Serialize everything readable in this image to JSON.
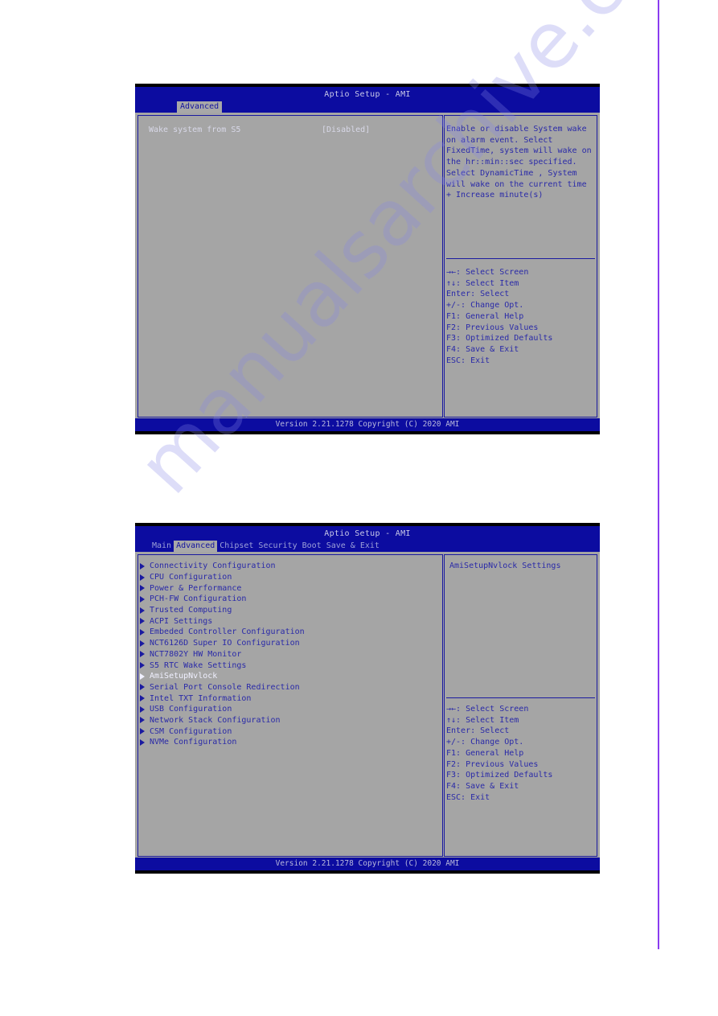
{
  "watermark": "manualsarchive.com",
  "screens": [
    {
      "title": "Aptio Setup - AMI",
      "tabs": [
        {
          "label": "Advanced",
          "active": true
        }
      ],
      "settings": [
        {
          "label": "Wake system from S5",
          "value": "[Disabled]"
        }
      ],
      "help_text": [
        "Enable or disable System wake",
        "on alarm event. Select",
        "FixedTime, system will wake on",
        "the hr::min::sec specified.",
        "Select DynamicTime , System",
        "will wake on the current time",
        "+ Increase minute(s)"
      ],
      "keys": [
        "→←: Select Screen",
        "↑↓: Select Item",
        "Enter: Select",
        "+/-: Change Opt.",
        "F1: General Help",
        "F2: Previous Values",
        "F3: Optimized Defaults",
        "F4: Save & Exit",
        "ESC: Exit"
      ],
      "footer": "Version 2.21.1278 Copyright (C) 2020 AMI"
    },
    {
      "title": "Aptio Setup - AMI",
      "tabs": [
        {
          "label": "Main",
          "active": false
        },
        {
          "label": "Advanced",
          "active": true
        },
        {
          "label": "Chipset",
          "active": false
        },
        {
          "label": "Security",
          "active": false
        },
        {
          "label": "Boot",
          "active": false
        },
        {
          "label": "Save & Exit",
          "active": false
        }
      ],
      "menu": [
        "Connectivity Configuration",
        "CPU Configuration",
        "Power & Performance",
        "PCH-FW Configuration",
        "Trusted Computing",
        "ACPI Settings",
        "Embeded Controller Configuration",
        "NCT6126D Super IO Configuration",
        "NCT7802Y HW Monitor",
        "S5 RTC Wake Settings",
        "AmiSetupNvlock",
        "Serial Port Console Redirection",
        "Intel TXT Information",
        "USB Configuration",
        "Network Stack Configuration",
        "CSM Configuration",
        "NVMe Configuration"
      ],
      "selected_index": 10,
      "help_text": [
        "AmiSetupNvlock Settings"
      ],
      "keys": [
        "→←: Select Screen",
        "↑↓: Select Item",
        "Enter: Select",
        "+/-: Change Opt.",
        "F1: General Help",
        "F2: Previous Values",
        "F3: Optimized Defaults",
        "F4: Save & Exit",
        "ESC: Exit"
      ],
      "footer": "Version 2.21.1278 Copyright (C) 2020 AMI"
    }
  ]
}
